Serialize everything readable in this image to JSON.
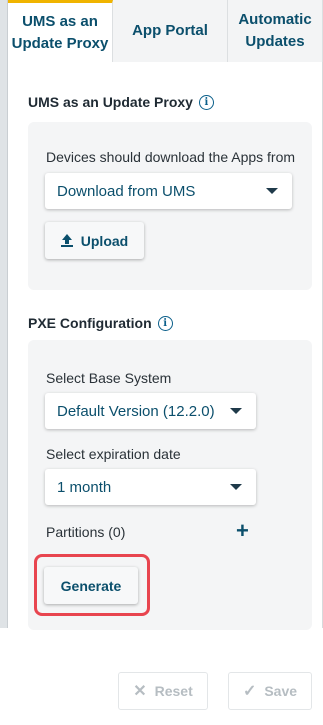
{
  "tabs": [
    {
      "label": "UMS as an\nUpdate Proxy",
      "active": true
    },
    {
      "label": "App Portal",
      "active": false
    },
    {
      "label": "Automatic\nUpdates",
      "active": false
    }
  ],
  "ums_section": {
    "title": "UMS as an Update Proxy",
    "info_icon": "info-icon",
    "devices_label": "Devices should download the Apps from ....",
    "download_select": "Download from UMS",
    "upload_button": "Upload"
  },
  "pxe_section": {
    "title": "PXE Configuration",
    "info_icon": "info-icon",
    "base_system_label": "Select Base System",
    "base_system_select": "Default Version (12.2.0)",
    "expiration_label": "Select expiration date",
    "expiration_select": "1 month",
    "partitions_label": "Partitions (0)",
    "add_icon": "+",
    "generate_button": "Generate"
  },
  "footer": {
    "reset_label": "Reset",
    "save_label": "Save",
    "reset_icon": "✕",
    "save_icon": "✓"
  },
  "colors": {
    "accent": "#0b4f6c",
    "tab_indicator": "#f0b400",
    "highlight": "#e8454f"
  }
}
